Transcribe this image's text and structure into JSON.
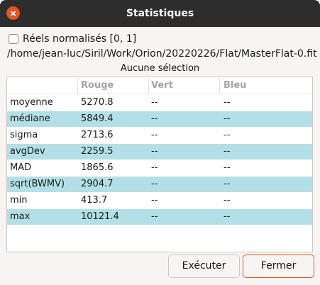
{
  "window": {
    "title": "Statistiques"
  },
  "options": {
    "normalized_label": "Réels normalisés [0, 1]",
    "normalized_checked": false
  },
  "file_path": "/home/jean-luc/Siril/Work/Orion/20220226/Flat/MasterFlat-0.fit",
  "selection_status": "Aucune sélection",
  "table": {
    "columns": [
      "",
      "Rouge",
      "Vert",
      "Bleu"
    ],
    "rows": [
      [
        "moyenne",
        "5270.8",
        "--",
        "--"
      ],
      [
        "médiane",
        "5849.4",
        "--",
        "--"
      ],
      [
        "sigma",
        "2713.6",
        "--",
        "--"
      ],
      [
        "avgDev",
        "2259.5",
        "--",
        "--"
      ],
      [
        "MAD",
        "1865.6",
        "--",
        "--"
      ],
      [
        "sqrt(BWMV)",
        "2904.7",
        "--",
        "--"
      ],
      [
        "min",
        "413.7",
        "--",
        "--"
      ],
      [
        "max",
        "10121.4",
        "--",
        "--"
      ]
    ]
  },
  "buttons": {
    "execute": "Exécuter",
    "close": "Fermer"
  },
  "colors": {
    "titlebar": "#2d2d2d",
    "close_button": "#e9541f",
    "row_highlight": "#b3e0e6"
  }
}
